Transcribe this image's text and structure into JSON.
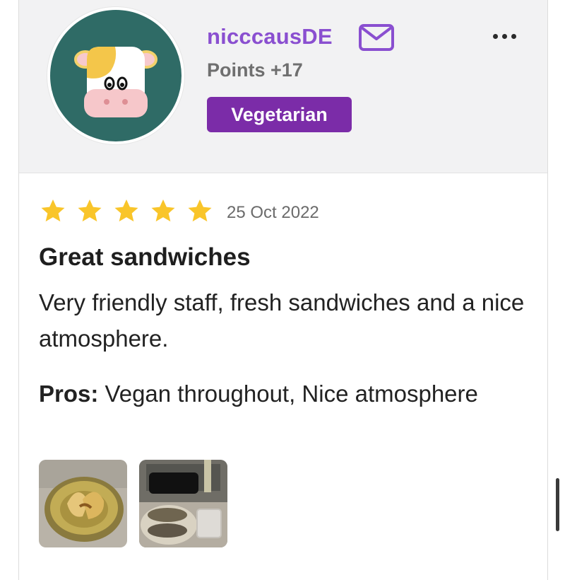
{
  "review": {
    "user": {
      "username": "nicccausDE",
      "points": "Points +17",
      "badge": "Vegetarian",
      "avatar_icon": "cow-avatar-icon",
      "badge_color": "#7b2ca8",
      "username_color": "#8a4fd0"
    },
    "rating": 5,
    "rating_max": 5,
    "star_color": "#f9c52a",
    "date": "25 Oct 2022",
    "title": "Great sandwiches",
    "body": "Very friendly staff, fresh sandwiches and a nice atmosphere.",
    "pros_label": "Pros:",
    "pros_text": " Vegan throughout, Nice atmosphere",
    "photos": [
      "photo-food-plate",
      "photo-sandwich-table"
    ]
  }
}
